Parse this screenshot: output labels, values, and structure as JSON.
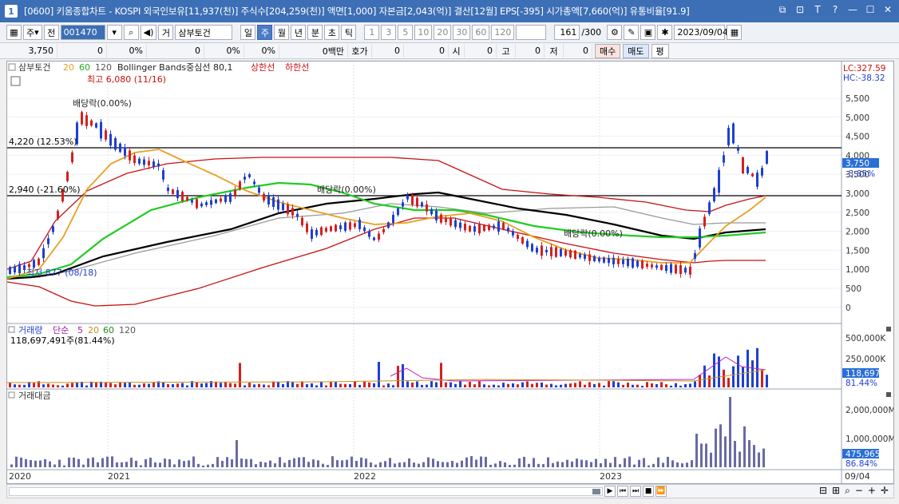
{
  "window": {
    "title": "[0600] 키움종합차트 - KOSPI 외국인보유[11,937(천)] 주식수[204,259(천)] 액면[1,000] 자본금[2,043(억)] 결산[12월] EPS[-395] 시가총액[7,660(억)] 유통비율[91.9]",
    "icon_label": "1",
    "controls": [
      "⧉",
      "⊡",
      "T",
      "?",
      "—",
      "☐",
      "✕"
    ]
  },
  "toolbar": {
    "mode_select": "주",
    "prev_label": "전",
    "code": "001470",
    "category_select": "거",
    "stock_name": "삼부토건",
    "periods": [
      "일",
      "주",
      "월",
      "년",
      "분",
      "초",
      "틱"
    ],
    "selected_period": "주",
    "intervals": [
      "1",
      "3",
      "5",
      "10",
      "20",
      "30",
      "60",
      "120"
    ],
    "count": "161",
    "count_total": "/300",
    "date": "2023/09/04"
  },
  "quote_bar": {
    "price": "3,750",
    "change": "0",
    "change_pct": "0%",
    "volume": "0",
    "volume_pct": "0%",
    "amount_pct": "0%",
    "amount_label": "0백만",
    "hoga_label": "호가",
    "hoga_value1": "0",
    "hoga_value2": "0",
    "open_label": "시",
    "open_value": "0",
    "high_label": "고",
    "high_value": "0",
    "low_label": "저",
    "low_value": "0",
    "buy_label": "매수",
    "sell_label": "매도",
    "eval_label": "평"
  },
  "price_panel": {
    "legend": {
      "stock": "삼부토건",
      "ma_labels": [
        "20",
        "60",
        "120"
      ],
      "bollinger": "Bollinger Bands중심선 80,1",
      "upper": "상한선",
      "lower": "하한선"
    },
    "annotations": {
      "high": "최고 6,080 (11/16)",
      "low": "최저 877 (08/18)",
      "dividend": "배당락(0.00%)",
      "line_upper": "4,220 (12.53%)",
      "line_lower": "2,940 (-21.60%)"
    },
    "lc": "LC:327.59",
    "hc": "HC:-38.32",
    "price_tag": "3,750",
    "price_tag_pct": "-3.85%",
    "y_ticks": [
      "5,500",
      "5,000",
      "4,500",
      "4,000",
      "3,500",
      "3,000",
      "2,500",
      "2,000",
      "1,500",
      "1,000",
      "500",
      "0"
    ]
  },
  "volume_panel": {
    "legend_title": "거래량",
    "legend_ma": "단순",
    "legend_periods": [
      "5",
      "20",
      "60",
      "120"
    ],
    "value_label": "118,697,491주(81.44%)",
    "y_ticks": [
      "500,000K",
      "250,000K"
    ],
    "tag": "118,697K",
    "tag_pct": "81.44%"
  },
  "amount_panel": {
    "legend_title": "거래대금",
    "y_ticks": [
      "2,000,000M",
      "1,000,000M"
    ],
    "tag": "475,965M",
    "tag_pct": "86.84%"
  },
  "x_axis": {
    "labels": [
      "2020",
      "2021",
      "2022",
      "2023",
      "09/04"
    ]
  },
  "colors": {
    "up": "#d32020",
    "down": "#1f3fd0",
    "ma20": "#e8a020",
    "ma60": "#22cc22",
    "ma120": "#000000",
    "bollinger": "#c81010",
    "mid_gray": "#999999",
    "tag_blue": "#2a6fd6"
  },
  "scroll_controls": [
    "▶",
    "⏮",
    "⏭",
    "■",
    "⏩"
  ],
  "zoom_controls": [
    "⊟",
    "⊞",
    "⌕",
    "−",
    "+",
    "✛"
  ]
}
